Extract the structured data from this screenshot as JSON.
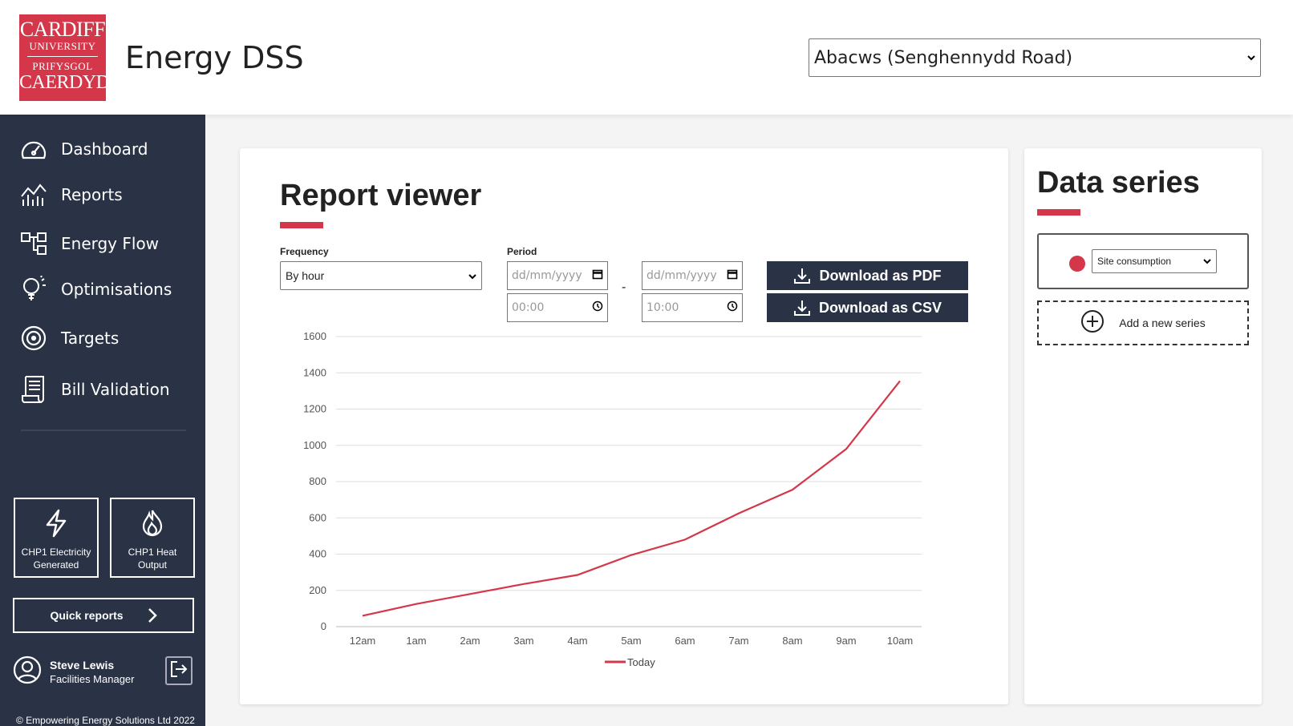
{
  "header": {
    "logo": {
      "line1": "CARDIFF",
      "line2": "UNIVERSITY",
      "line3": "PRIFYSGOL",
      "line4": "CAERDYD"
    },
    "app_title": "Energy DSS",
    "site_select": "Abacws (Senghennydd Road)"
  },
  "sidebar": {
    "items": [
      {
        "label": "Dashboard",
        "icon": "gauge-icon"
      },
      {
        "label": "Reports",
        "icon": "chart-icon"
      },
      {
        "label": "Energy Flow",
        "icon": "flow-icon"
      },
      {
        "label": "Optimisations",
        "icon": "lightbulb-icon"
      },
      {
        "label": "Targets",
        "icon": "target-icon"
      },
      {
        "label": "Bill Validation",
        "icon": "bill-icon"
      }
    ],
    "quick_tiles": [
      {
        "label": "CHP1 Electricity Generated",
        "icon": "lightning-icon"
      },
      {
        "label": "CHP1 Heat Output",
        "icon": "flame-icon"
      }
    ],
    "quick_reports": "Quick reports",
    "user": {
      "name": "Steve Lewis",
      "role": "Facilities Manager"
    },
    "copyright": "© Empowering Energy Solutions Ltd 2022"
  },
  "report": {
    "title": "Report viewer",
    "frequency_label": "Frequency",
    "frequency_value": "By hour",
    "period_label": "Period",
    "from_date": "dd/mm/yyyy",
    "from_time": "00:00",
    "to_date": "dd/mm/yyyy",
    "to_time": "10:00",
    "period_sep": "-",
    "download_pdf": "Download as PDF",
    "download_csv": "Download as CSV"
  },
  "chart_data": {
    "type": "line",
    "categories": [
      "12am",
      "1am",
      "2am",
      "3am",
      "4am",
      "5am",
      "6am",
      "7am",
      "8am",
      "9am",
      "10am"
    ],
    "series": [
      {
        "name": "Today",
        "values": [
          60,
          125,
          180,
          235,
          285,
          395,
          480,
          625,
          755,
          980,
          1355
        ],
        "color": "#d4374a"
      }
    ],
    "ylim": [
      0,
      1600
    ],
    "yticks": [
      0,
      200,
      400,
      600,
      800,
      1000,
      1200,
      1400,
      1600
    ],
    "grid": true,
    "legend": "bottom"
  },
  "series_panel": {
    "title": "Data series",
    "series_select": "Site consumption",
    "add_series": "Add a new series"
  },
  "colors": {
    "accent": "#d4374a",
    "sidebar": "#2a3245"
  }
}
